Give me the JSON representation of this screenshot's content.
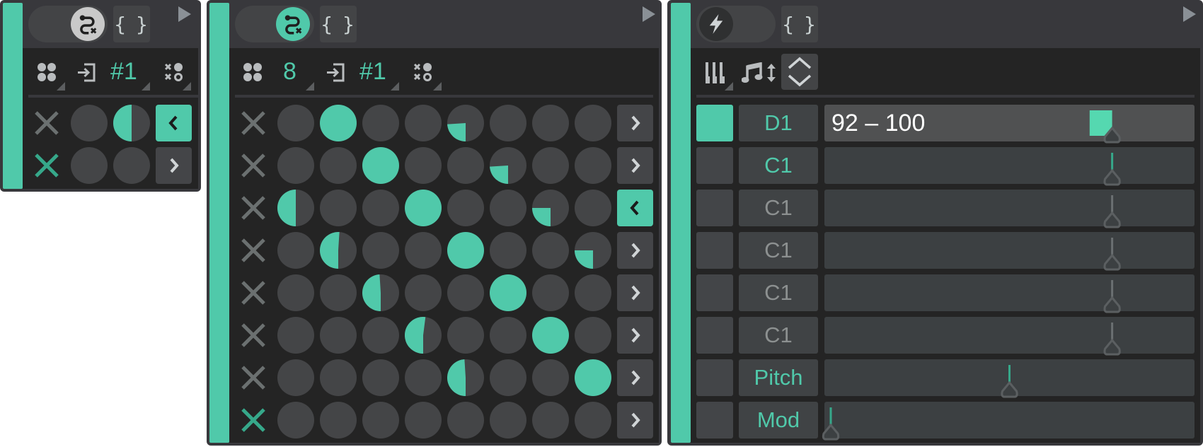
{
  "theme": {
    "accent": "#50c9aa",
    "accent_dark": "#36a88a",
    "range_fill": "#55d8b0",
    "cell_empty": "#444547",
    "icon_light": "#b9bcbe",
    "x_muted": "#6b7070",
    "line_muted": "#6b7072",
    "marker": "#5b5f61"
  },
  "panels": {
    "p1": {
      "toggle": {
        "state": "on",
        "icon": "route-icon",
        "knob_color": "#c9c9c9"
      },
      "code_button": {
        "label": "{ }"
      },
      "play_icon": "play-icon",
      "toolbar": {
        "steps_icon": "dots-grid-icon",
        "input_icon": "import-icon",
        "channel": "#1",
        "mode_icon": "xo-pattern-icon"
      },
      "grid": {
        "rows": [
          {
            "x_active": false,
            "cells": [
              0,
              0.5
            ],
            "button": "left",
            "button_active": true
          },
          {
            "x_active": true,
            "cells": [
              0,
              0
            ],
            "button": "right",
            "button_active": false
          }
        ]
      }
    },
    "p2": {
      "toggle": {
        "state": "on",
        "icon": "route-icon",
        "knob_color": "#50c9aa"
      },
      "code_button": {
        "label": "{ }"
      },
      "play_icon": "play-icon",
      "toolbar": {
        "steps_icon": "dots-grid-icon",
        "steps": "8",
        "input_icon": "import-icon",
        "channel": "#1",
        "mode_icon": "xo-pattern-icon"
      },
      "grid": {
        "rows": [
          {
            "x_active": false,
            "cells": [
              0,
              1,
              0,
              0,
              0.24,
              0,
              0,
              0
            ],
            "button": "right",
            "button_active": false
          },
          {
            "x_active": false,
            "cells": [
              0,
              0,
              1,
              0,
              0,
              0.24,
              0,
              0
            ],
            "button": "right",
            "button_active": false
          },
          {
            "x_active": false,
            "cells": [
              0.5,
              0,
              0,
              1,
              0,
              0,
              0.25,
              0
            ],
            "button": "left",
            "button_active": true
          },
          {
            "x_active": false,
            "cells": [
              0,
              0.51,
              0,
              0,
              1,
              0,
              0,
              0.25
            ],
            "button": "right",
            "button_active": false
          },
          {
            "x_active": false,
            "cells": [
              0,
              0,
              0.49,
              0,
              0,
              1,
              0,
              0
            ],
            "button": "right",
            "button_active": false
          },
          {
            "x_active": false,
            "cells": [
              0,
              0,
              0,
              0.52,
              0,
              0,
              1,
              0
            ],
            "button": "right",
            "button_active": false
          },
          {
            "x_active": false,
            "cells": [
              0,
              0,
              0,
              0,
              0.49,
              0,
              0,
              1
            ],
            "button": "right",
            "button_active": false
          },
          {
            "x_active": true,
            "cells": [
              0,
              0,
              0,
              0,
              0,
              0,
              0,
              0
            ],
            "button": "right",
            "button_active": false
          }
        ]
      }
    },
    "p3": {
      "toggle": {
        "state": "off",
        "icon": "lightning-icon"
      },
      "code_button": {
        "label": "{ }"
      },
      "play_icon": "play-icon",
      "toolbar": {
        "keys_icon": "piano-keys-icon",
        "transpose_icon": "note-up-down-icon",
        "stepper_icon": "chevron-up-down-icon"
      },
      "rows": [
        {
          "enabled": true,
          "label": "D1",
          "label_active": true,
          "value_text": "92 – 100",
          "range": [
            92,
            100
          ],
          "value": 100,
          "min": 0,
          "max": 127,
          "highlight": true,
          "line_active": false
        },
        {
          "enabled": false,
          "label": "C1",
          "label_active": true,
          "value": 100,
          "min": 0,
          "max": 127,
          "highlight": false,
          "line_active": true
        },
        {
          "enabled": false,
          "label": "C1",
          "label_active": false,
          "value": 100,
          "min": 0,
          "max": 127,
          "highlight": false,
          "line_active": false
        },
        {
          "enabled": false,
          "label": "C1",
          "label_active": false,
          "value": 100,
          "min": 0,
          "max": 127,
          "highlight": false,
          "line_active": false
        },
        {
          "enabled": false,
          "label": "C1",
          "label_active": false,
          "value": 100,
          "min": 0,
          "max": 127,
          "highlight": false,
          "line_active": false
        },
        {
          "enabled": false,
          "label": "C1",
          "label_active": false,
          "value": 100,
          "min": 0,
          "max": 127,
          "highlight": false,
          "line_active": false
        },
        {
          "enabled": false,
          "label": "Pitch",
          "label_active": true,
          "value": 0,
          "min": -8192,
          "max": 8191,
          "highlight": false,
          "line_active": true
        },
        {
          "enabled": false,
          "label": "Mod",
          "label_active": true,
          "value": 0,
          "min": 0,
          "max": 127,
          "highlight": false,
          "line_active": true
        }
      ]
    }
  }
}
